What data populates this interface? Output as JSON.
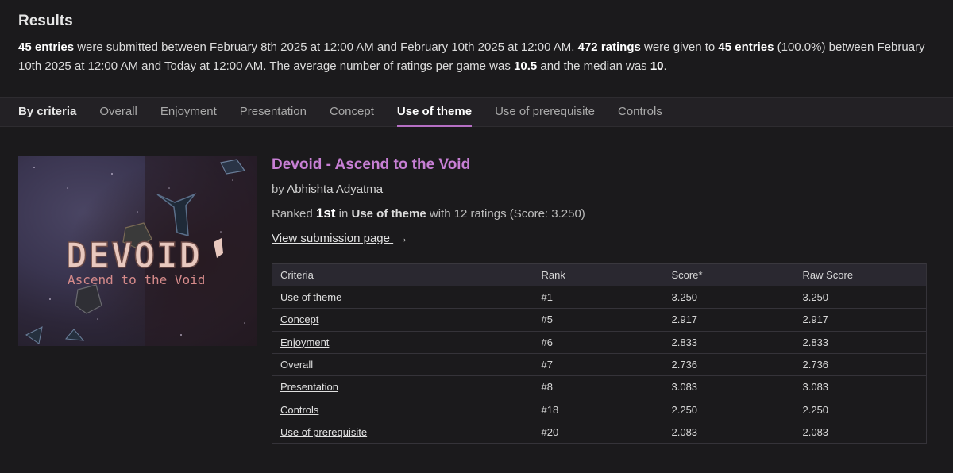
{
  "page": {
    "results_title": "Results",
    "summary": {
      "entries_count": "45 entries",
      "part1": " were submitted between February 8th 2025 at 12:00 AM and February 10th 2025 at 12:00 AM. ",
      "ratings_count": "472 ratings",
      "part2": " were given to ",
      "entries_count2": "45 entries",
      "part3": " (100.0%) between February 10th 2025 at 12:00 AM and Today at 12:00 AM. The average number of ratings per game was ",
      "avg": "10.5",
      "part4": " and the median was ",
      "median": "10",
      "part5": "."
    }
  },
  "tabs": {
    "label": "By criteria",
    "items": [
      "Overall",
      "Enjoyment",
      "Presentation",
      "Concept",
      "Use of theme",
      "Use of prerequisite",
      "Controls"
    ],
    "active": "Use of theme"
  },
  "entry": {
    "title": "Devoid - Ascend to the Void",
    "by_prefix": "by",
    "author": "Abhishta Adyatma",
    "ranked_prefix": "Ranked",
    "rank": "1st",
    "ranked_in": "in",
    "criteria": "Use of theme",
    "ranked_suffix": "with 12 ratings (Score: 3.250)",
    "view_link": "View submission page",
    "arrow": "→",
    "thumbnail": {
      "logo_text": "DEVOID",
      "subtitle": "Ascend to the Void",
      "colors": {
        "logo": "#e8c8be",
        "subtitle": "#d58a8a",
        "space": "#3a3550"
      }
    }
  },
  "table": {
    "headers": [
      "Criteria",
      "Rank",
      "Score*",
      "Raw Score"
    ],
    "rows": [
      {
        "criteria": "Use of theme",
        "rank": "#1",
        "score": "3.250",
        "raw": "3.250",
        "link": true
      },
      {
        "criteria": "Concept",
        "rank": "#5",
        "score": "2.917",
        "raw": "2.917",
        "link": true
      },
      {
        "criteria": "Enjoyment",
        "rank": "#6",
        "score": "2.833",
        "raw": "2.833",
        "link": true
      },
      {
        "criteria": "Overall",
        "rank": "#7",
        "score": "2.736",
        "raw": "2.736",
        "link": false
      },
      {
        "criteria": "Presentation",
        "rank": "#8",
        "score": "3.083",
        "raw": "3.083",
        "link": true
      },
      {
        "criteria": "Controls",
        "rank": "#18",
        "score": "2.250",
        "raw": "2.250",
        "link": true
      },
      {
        "criteria": "Use of prerequisite",
        "rank": "#20",
        "score": "2.083",
        "raw": "2.083",
        "link": true
      }
    ]
  },
  "colors": {
    "background": "#1b1a1c",
    "accent": "#c77fd4",
    "tab_underline": "#b56fc4"
  }
}
